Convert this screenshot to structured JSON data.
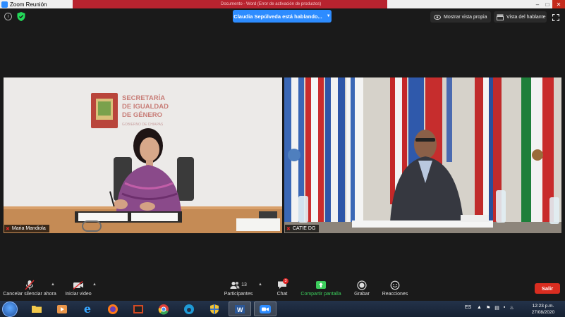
{
  "window": {
    "title": "Zoom Reunión",
    "strip_text": "Documento - Word (Error de activación de productos)"
  },
  "topbar": {
    "speaker_banner": "Claudia Sepúlveda está hablando...",
    "show_self_view": "Mostrar vista propia",
    "speaker_view": "Vista del hablante"
  },
  "tiles": {
    "left": {
      "name": "Maria Mandiola",
      "sign_line1": "SECRETARÍA",
      "sign_line2": "DE IGUALDAD",
      "sign_line3": "DE GÉNERO",
      "sign_line4": "GOBIERNO DE CHIAPAS"
    },
    "right": {
      "name": "CATIE DG"
    }
  },
  "toolbar": {
    "mute_label": "Cancelar silenciar ahora",
    "video_label": "Iniciar video",
    "participants_label": "Participantes",
    "participants_count": "13",
    "chat_label": "Chat",
    "chat_badge": "3",
    "share_label": "Compartir pantalla",
    "record_label": "Grabar",
    "reactions_label": "Reacciones",
    "leave_label": "Salir"
  },
  "taskbar": {
    "language": "ES",
    "time": "12:23 p.m.",
    "date": "27/08/2020"
  },
  "colors": {
    "zoom_blue": "#2d8cff",
    "share_green": "#3ccd5c",
    "leave_red": "#d92d20",
    "mic_off_red": "#e02828"
  }
}
